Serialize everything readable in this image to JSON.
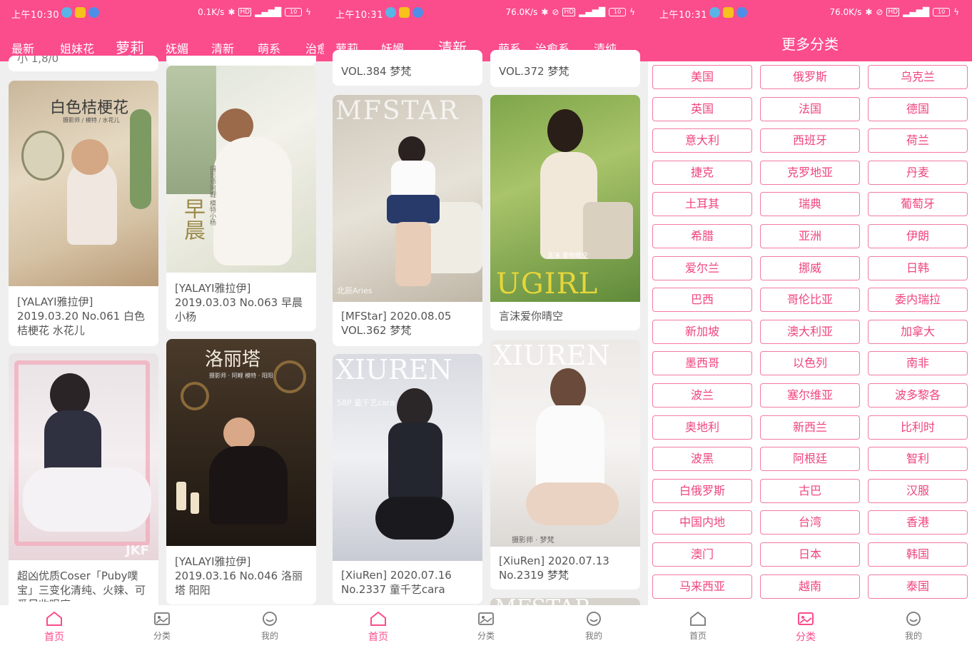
{
  "screens": [
    {
      "status": {
        "time": "上午10:30",
        "speed": "0.1K/s",
        "battery": "10"
      },
      "tabs": [
        "最新",
        "姐妹花",
        "萝莉",
        "妩媚",
        "清新",
        "萌系",
        "治愈姐妹花"
      ],
      "active_tab": 2,
      "peek_text": "小 1,8/0",
      "cards": [
        {
          "text": "[YALAYI雅拉伊]\n2019.03.20 No.061 白色\n桔梗花 水花儿",
          "overlay": "白色桔梗花",
          "overlay_sub": "摄影师 / 模特 / 水花儿"
        },
        {
          "text": "[YALAYI雅拉伊]\n2019.03.03 No.063 早晨\n小杨",
          "overlay": "早晨",
          "overlay_sub": "摄影师阿鲤 模特小杨"
        },
        {
          "text": "超凶优质Coser「Puby噗\n宝」三变化清纯、火辣、可\n爱尽收眼底",
          "overlay": "JKF",
          "overlay_sub": ""
        },
        {
          "text": "[YALAYI雅拉伊]\n2019.03.16 No.046 洛丽\n塔 阳阳",
          "overlay": "洛丽塔",
          "overlay_sub": "摄影师 · 阿鲤   模特 · 阳阳"
        }
      ],
      "nav": [
        "首页",
        "分类",
        "我的"
      ],
      "active_nav": 0
    },
    {
      "status": {
        "time": "上午10:31",
        "speed": "76.0K/s",
        "battery": "10"
      },
      "tabs": [
        "萝莉",
        "妩媚",
        "清新",
        "萌系",
        "治愈系",
        "清纯"
      ],
      "active_tab": 2,
      "peek_left": "VOL.384 梦梵",
      "peek_right": "VOL.372 梦梵",
      "cards": [
        {
          "text": "[MFStar] 2020.08.05\nVOL.362 梦梵",
          "overlay": "MFSTAR",
          "overlay_sub": "北辰Aries"
        },
        {
          "text": "言沫爱你晴空",
          "overlay": "UGIRL",
          "overlay_sub": "言沫 爱你晴空"
        },
        {
          "text": "[XiuRen] 2020.07.16\nNo.2337 童千艺cara",
          "overlay": "XIUREN",
          "overlay_sub": "58P 童千艺cara"
        },
        {
          "text": "[XiuRen] 2020.07.13\nNo.2319 梦梵",
          "overlay": "XIUREN",
          "overlay_sub": "摄影师 · 梦梵"
        },
        {
          "text": "",
          "overlay": "MFSTAR",
          "overlay_sub": ""
        }
      ],
      "nav": [
        "首页",
        "分类",
        "我的"
      ],
      "active_nav": 0
    },
    {
      "status": {
        "time": "上午10:31",
        "speed": "76.0K/s",
        "battery": "10"
      },
      "title": "更多分类",
      "categories": [
        "美国",
        "俄罗斯",
        "乌克兰",
        "英国",
        "法国",
        "德国",
        "意大利",
        "西班牙",
        "荷兰",
        "捷克",
        "克罗地亚",
        "丹麦",
        "土耳其",
        "瑞典",
        "葡萄牙",
        "希腊",
        "亚洲",
        "伊朗",
        "爱尔兰",
        "挪威",
        "日韩",
        "巴西",
        "哥伦比亚",
        "委内瑞拉",
        "新加坡",
        "澳大利亚",
        "加拿大",
        "墨西哥",
        "以色列",
        "南非",
        "波兰",
        "塞尔维亚",
        "波多黎各",
        "奥地利",
        "新西兰",
        "比利时",
        "波黑",
        "阿根廷",
        "智利",
        "白俄罗斯",
        "古巴",
        "汉服",
        "中国内地",
        "台湾",
        "香港",
        "澳门",
        "日本",
        "韩国",
        "马来西亚",
        "越南",
        "泰国"
      ],
      "nav": [
        "首页",
        "分类",
        "我的"
      ],
      "active_nav": 1
    }
  ],
  "colors": {
    "accent": "#fb4c8c",
    "category_text": "#f0437f",
    "tab_indicator": "#a9d8f5"
  },
  "icons": [
    "home-icon",
    "gallery-icon",
    "smiley-icon",
    "bluetooth-icon",
    "signal-icon",
    "battery-icon"
  ]
}
